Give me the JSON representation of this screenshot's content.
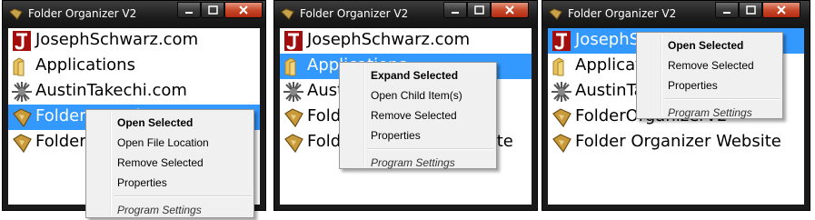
{
  "app_title": "Folder Organizer V2",
  "items": [
    {
      "label": "JosephSchwarz.com",
      "icon": "j-logo-icon"
    },
    {
      "label": "Applications",
      "icon": "folder-icon"
    },
    {
      "label": "AustinTakechi.com",
      "icon": "starburst-icon"
    },
    {
      "label": "FolderOrganizerV2",
      "icon": "folder-organizer-icon"
    },
    {
      "label": "Folder Organizer Website",
      "icon": "folder-organizer-icon"
    }
  ],
  "windows": [
    {
      "selected_index": 3,
      "menu": [
        {
          "label": "Open Selected",
          "bold": true
        },
        {
          "label": "Open File Location"
        },
        {
          "label": "Remove Selected"
        },
        {
          "label": "Properties"
        },
        {
          "separator": true
        },
        {
          "label": "Program Settings",
          "italic": true
        }
      ]
    },
    {
      "selected_index": 1,
      "menu": [
        {
          "label": "Expand Selected",
          "bold": true
        },
        {
          "label": "Open Child Item(s)"
        },
        {
          "label": "Remove Selected"
        },
        {
          "label": "Properties"
        },
        {
          "separator": true
        },
        {
          "label": "Program Settings",
          "italic": true
        }
      ]
    },
    {
      "selected_index": 0,
      "menu": [
        {
          "label": "Open Selected",
          "bold": true
        },
        {
          "label": "Remove Selected"
        },
        {
          "label": "Properties"
        },
        {
          "separator": true
        },
        {
          "label": "Program Settings",
          "italic": true
        }
      ]
    }
  ],
  "colors": {
    "selection": "#3399ff",
    "titlebar": "#1c1c1c",
    "close_button": "#c74a2b"
  }
}
